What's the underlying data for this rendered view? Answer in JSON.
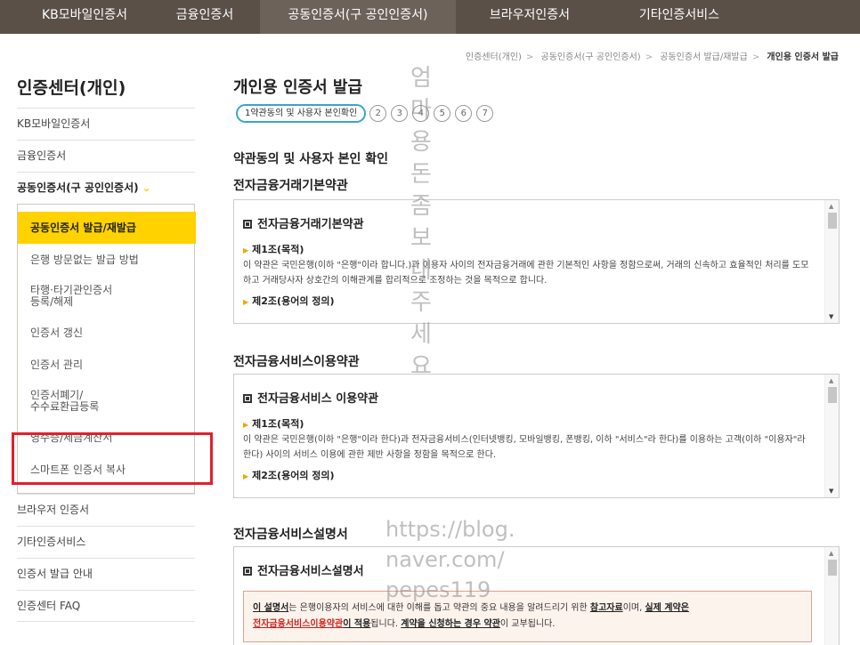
{
  "topnav": {
    "items": [
      "KB모바일인증서",
      "금융인증서",
      "공동인증서(구 공인인증서)",
      "브라우저인증서",
      "기타인증서비스"
    ]
  },
  "breadcrumb": {
    "items": [
      "인증센터(개인)",
      "공동인증서(구 공인인증서)",
      "공동인증서 발급/재발급"
    ],
    "current": "개인용 인증서 발급"
  },
  "sidebar": {
    "title": "인증센터(개인)",
    "top_items": [
      "KB모바일인증서",
      "금융인증서"
    ],
    "open_item": "공동인증서(구 공인인증서)",
    "sub_items": [
      "공동인증서 발급/재발급",
      "은행 방문없는 발급 방법",
      "타행·타기관인증서\n등록/해제",
      "인증서 갱신",
      "인증서 관리",
      "인증서폐기/\n수수료환급등록",
      "영수증/세금계산서",
      "스마트폰 인증서 복사"
    ],
    "bottom_items": [
      "브라우저 인증서",
      "기타인증서비스",
      "인증서 발급 안내",
      "인증센터 FAQ"
    ]
  },
  "main": {
    "title": "개인용 인증서 발급",
    "step_active": "1약관동의 및 사용자 본인확인",
    "steps": [
      "2",
      "3",
      "4",
      "5",
      "6",
      "7"
    ],
    "section_heading": "약관동의 및 사용자 본인 확인",
    "terms": [
      {
        "heading": "전자금융거래기본약관",
        "box_title": "전자금융거래기본약관",
        "art1": "제1조(목적)",
        "text": "이 약관은 국민은행(이하 \"은행\"이라 합니다.)과 이용자 사이의 전자금융거래에 관한 기본적인 사항을 정함으로써, 거래의 신속하고 효율적인 처리를 도모하고 거래당사자 상호간의 이해관계를 합리적으로 조정하는 것을 목적으로 합니다.",
        "art2": "제2조(용어의 정의)"
      },
      {
        "heading": "전자금융서비스이용약관",
        "box_title": "전자금융서비스 이용약관",
        "art1": "제1조(목적)",
        "text": "이 약관은 국민은행(이하 \"은행\"이라 한다)과 전자금융서비스(인터넷뱅킹, 모바일뱅킹, 폰뱅킹, 이하 \"서비스\"라 한다)를 이용하는 고객(이하 \"이용자\"라 한다) 사이의 서비스 이용에 관한 제반 사항을 정함을 목적으로 한다.",
        "art2": "제2조(용어의 정의)"
      },
      {
        "heading": "전자금융서비스설명서",
        "box_title": "전자금융서비스설명서"
      }
    ],
    "notice": {
      "p1_a": "이 설명서",
      "p1_b": "는 은행이용자의 서비스에 대한 이해를 돕고 약관의 중요 내용을 알려드리기 위한 ",
      "p1_c": "참고자료",
      "p1_d": "이며, ",
      "p1_e": "실제 계약은",
      "p2_a": "전자금융서비스이용약관",
      "p2_b": "이 적용",
      "p2_c": "됩니다. ",
      "p2_d": "계약을 신청하는 경우 약관",
      "p2_e": "이 교부됩니다."
    }
  },
  "watermark": {
    "vertical": [
      "엄",
      "마",
      "용",
      "돈",
      "좀",
      "보",
      "내",
      "주",
      "세",
      "요"
    ],
    "url_lines": [
      "https://blog.",
      "naver.com/",
      "pepes119"
    ]
  }
}
